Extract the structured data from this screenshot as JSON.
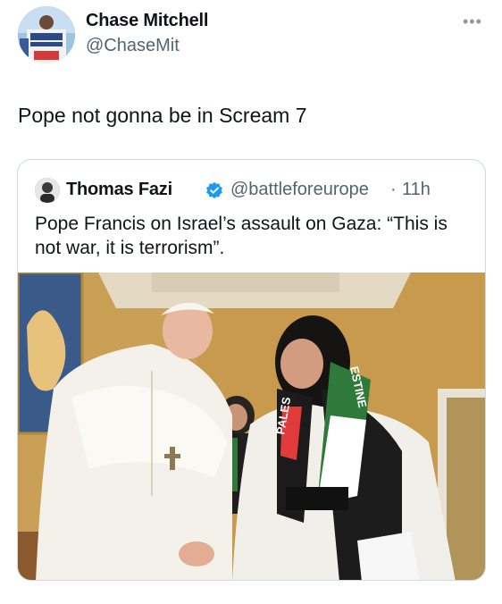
{
  "author": {
    "name": "Chase Mitchell",
    "handle": "@ChaseMit",
    "avatar_icon": "profile-photo"
  },
  "more_icon": "more-dots-icon",
  "tweet_text": "Pope not gonna be in Scream 7",
  "quoted": {
    "name": "Thomas Fazi",
    "verified_icon": "verified-badge-icon",
    "verified_color": "#1d9bf0",
    "handle": "@battleforeurope",
    "separator": "·",
    "time": "11h",
    "text": "Pope Francis on Israel’s assault on Gaza: “This is not war, it is terrorism”.",
    "media": {
      "description_icon": "photo",
      "scarf_text_left": "PALES",
      "scarf_text_right": "ESTINE"
    }
  }
}
